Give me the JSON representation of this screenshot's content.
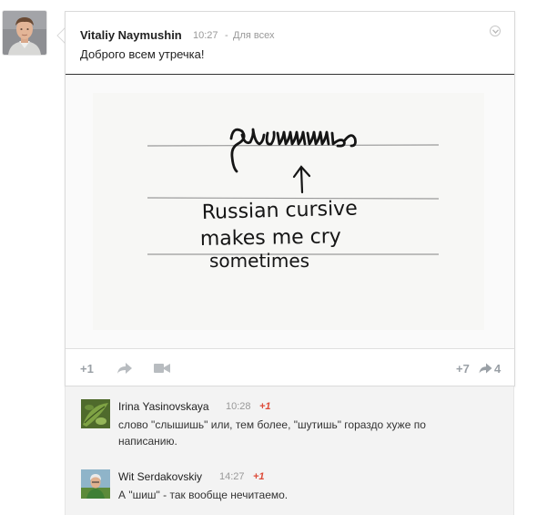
{
  "post": {
    "author": "Vitaliy Naymushin",
    "time": "10:27",
    "separator": "-",
    "visibility": "Для всех",
    "text": "Доброго всем утречка!",
    "photo": {
      "handwritten_word": "дышишь",
      "caption_lines": [
        "Russian cursive",
        "makes me cry",
        "sometimes"
      ]
    },
    "actions": {
      "plus_one_label": "+1",
      "plus_count": "+7",
      "share_count": "4",
      "icons": [
        "share-icon",
        "hangout-icon",
        "share-count-icon",
        "menu-chevron-icon"
      ]
    }
  },
  "comments": [
    {
      "author": "Irina Yasinovskaya",
      "time": "10:28",
      "plus": "+1",
      "text": "слово \"слышишь\" или, тем более, \"шутишь\" гораздо хуже по написанию."
    },
    {
      "author": "Wit Serdakovskiy",
      "time": "14:27",
      "plus": "+1",
      "text": "А \"шиш\" - так вообще нечитаемо."
    }
  ],
  "colors": {
    "accent_plus": "#dd4b39",
    "muted": "#999999",
    "comment_bg": "#f3f3f3"
  }
}
